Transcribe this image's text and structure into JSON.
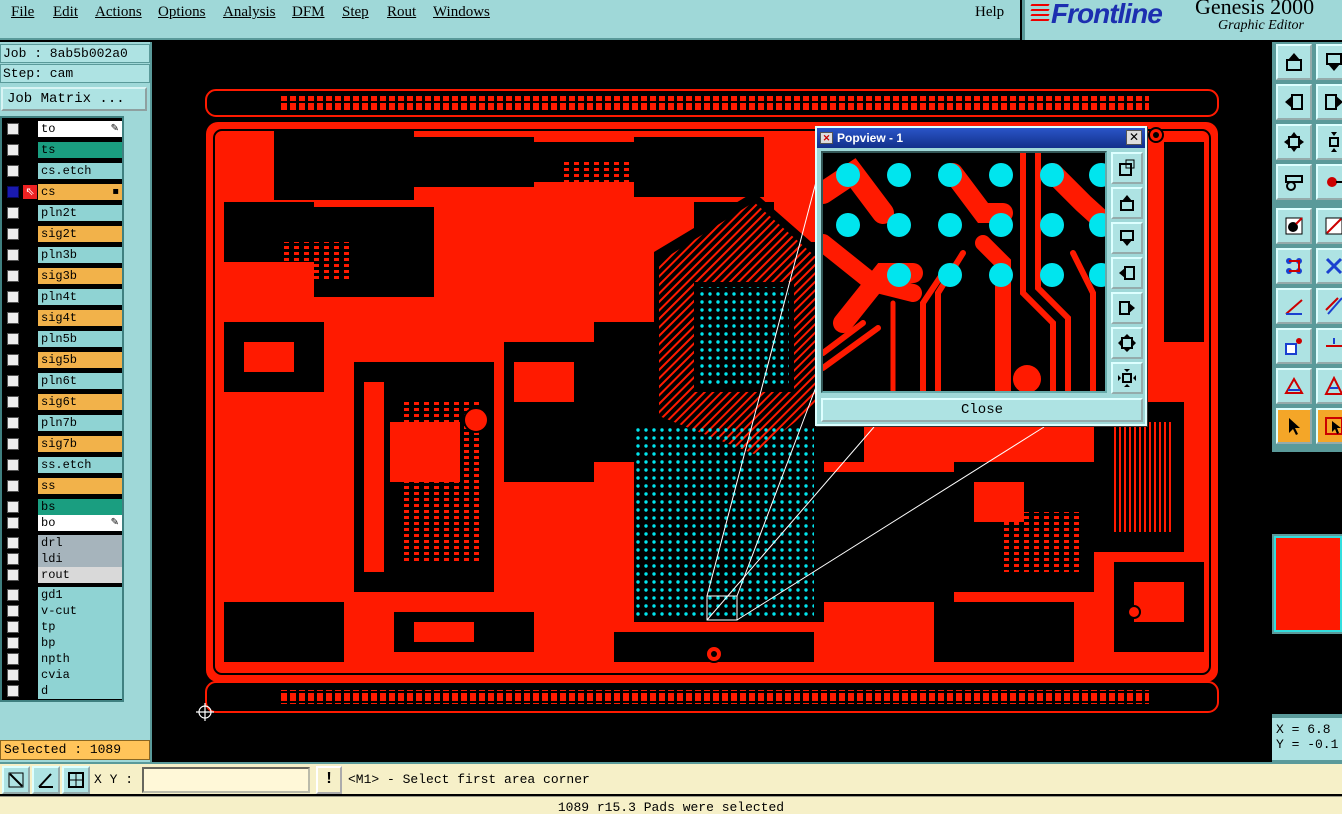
{
  "menu": {
    "items": [
      "File",
      "Edit",
      "Actions",
      "Options",
      "Analysis",
      "DFM",
      "Step",
      "Rout",
      "Windows"
    ],
    "help": "Help"
  },
  "brand": {
    "logo": "Frontline",
    "title": "Genesis 2000",
    "subtitle": "Graphic Editor"
  },
  "job": {
    "job_line": "Job : 8ab5b002a0",
    "step_line": "Step: cam",
    "matrix_button": "Job Matrix ..."
  },
  "layers": [
    {
      "name": "to",
      "color": "#ffffff",
      "mark": "✎"
    },
    {
      "name": "ts",
      "color": "#1a9e80"
    },
    {
      "name": "cs.etch",
      "color": "#8fd3d3"
    },
    {
      "name": "cs",
      "color": "#f2b24a",
      "active": true,
      "mark": "▪"
    },
    {
      "name": "pln2t",
      "color": "#8fd3d3"
    },
    {
      "name": "sig2t",
      "color": "#f2b24a"
    },
    {
      "name": "pln3b",
      "color": "#8fd3d3"
    },
    {
      "name": "sig3b",
      "color": "#f2b24a"
    },
    {
      "name": "pln4t",
      "color": "#8fd3d3"
    },
    {
      "name": "sig4t",
      "color": "#f2b24a"
    },
    {
      "name": "pln5b",
      "color": "#8fd3d3"
    },
    {
      "name": "sig5b",
      "color": "#f2b24a"
    },
    {
      "name": "pln6t",
      "color": "#8fd3d3"
    },
    {
      "name": "sig6t",
      "color": "#f2b24a"
    },
    {
      "name": "pln7b",
      "color": "#8fd3d3"
    },
    {
      "name": "sig7b",
      "color": "#f2b24a"
    },
    {
      "name": "ss.etch",
      "color": "#8fd3d3"
    },
    {
      "name": "ss",
      "color": "#f2b24a"
    },
    {
      "name": "bs",
      "color": "#1a9e80"
    },
    {
      "name": "bo",
      "color": "#ffffff",
      "mark": "✎"
    },
    {
      "name": "drl",
      "color": "#a6b4bc"
    },
    {
      "name": "ldi",
      "color": "#a6b4bc"
    },
    {
      "name": "rout",
      "color": "#d9d9d9"
    },
    {
      "name": "gd1",
      "color": "#8fd3d3"
    },
    {
      "name": "v-cut",
      "color": "#8fd3d3"
    },
    {
      "name": "tp",
      "color": "#8fd3d3"
    },
    {
      "name": "bp",
      "color": "#8fd3d3"
    },
    {
      "name": "npth",
      "color": "#8fd3d3"
    },
    {
      "name": "cvia",
      "color": "#8fd3d3"
    },
    {
      "name": "d",
      "color": "#8fd3d3"
    }
  ],
  "selected": "Selected : 1089",
  "popview": {
    "title": "Popview - 1",
    "close_button": "Close"
  },
  "coords": {
    "x": "X = 6.8",
    "y": "Y = -0.1"
  },
  "bottom": {
    "xy_label": "X Y :",
    "xy_value": "",
    "prompt": "<M1> - Select first area corner",
    "status": "1089 r15.3 Pads were selected"
  },
  "colors": {
    "copper": "#ff1a00",
    "pad": "#00e5ee",
    "panel": "#9fd8d8"
  }
}
